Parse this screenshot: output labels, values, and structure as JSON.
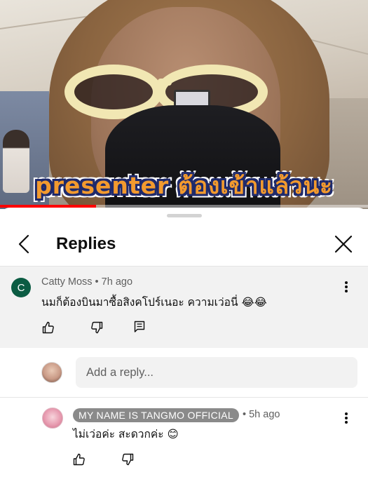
{
  "video": {
    "caption": "presenter ต้องเข้าแล้วนะ",
    "progress_percent": 26
  },
  "sheet": {
    "title": "Replies"
  },
  "parent_comment": {
    "avatar_letter": "C",
    "author": "Catty Moss",
    "time": "7h ago",
    "text": "นมก็ต้องบินมาซื้อสิงคโปร์เนอะ ความเว่อนี่ 😂😂"
  },
  "reply_box": {
    "placeholder": "Add a reply..."
  },
  "reply": {
    "author": "MY NAME IS TANGMO OFFICIAL",
    "time": "5h ago",
    "text": "ไม่เว่อค่ะ สะดวกค่ะ 😊"
  },
  "separator": "•",
  "colors": {
    "accent_red": "#ff0000",
    "avatar_green": "#0b5c43",
    "caption_orange": "#f29a2e",
    "caption_outline": "#1f2a6b"
  },
  "icons": [
    "back-arrow-icon",
    "close-icon",
    "like-icon",
    "dislike-icon",
    "reply-icon",
    "more-vert-icon"
  ]
}
